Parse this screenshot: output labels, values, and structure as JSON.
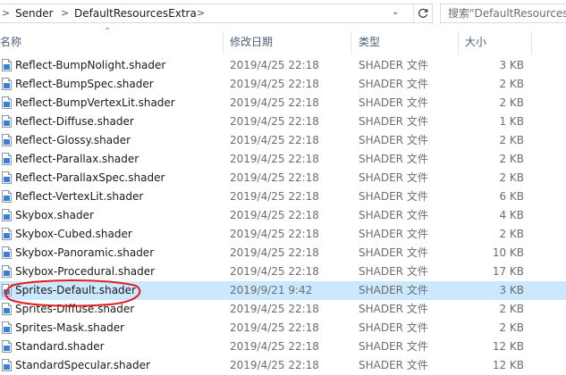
{
  "address_bar": {
    "crumbs": [
      "Sender",
      "DefaultResourcesExtra"
    ],
    "search_placeholder": "搜索\"DefaultResources"
  },
  "columns": {
    "name": "名称",
    "date": "修改日期",
    "type": "类型",
    "size": "大小"
  },
  "files": [
    {
      "name": "Reflect-BumpNolight.shader",
      "date": "2019/4/25 22:18",
      "type": "SHADER 文件",
      "size": "3 KB"
    },
    {
      "name": "Reflect-BumpSpec.shader",
      "date": "2019/4/25 22:18",
      "type": "SHADER 文件",
      "size": "2 KB"
    },
    {
      "name": "Reflect-BumpVertexLit.shader",
      "date": "2019/4/25 22:18",
      "type": "SHADER 文件",
      "size": "2 KB"
    },
    {
      "name": "Reflect-Diffuse.shader",
      "date": "2019/4/25 22:18",
      "type": "SHADER 文件",
      "size": "1 KB"
    },
    {
      "name": "Reflect-Glossy.shader",
      "date": "2019/4/25 22:18",
      "type": "SHADER 文件",
      "size": "2 KB"
    },
    {
      "name": "Reflect-Parallax.shader",
      "date": "2019/4/25 22:18",
      "type": "SHADER 文件",
      "size": "2 KB"
    },
    {
      "name": "Reflect-ParallaxSpec.shader",
      "date": "2019/4/25 22:18",
      "type": "SHADER 文件",
      "size": "2 KB"
    },
    {
      "name": "Reflect-VertexLit.shader",
      "date": "2019/4/25 22:18",
      "type": "SHADER 文件",
      "size": "6 KB"
    },
    {
      "name": "Skybox.shader",
      "date": "2019/4/25 22:18",
      "type": "SHADER 文件",
      "size": "4 KB"
    },
    {
      "name": "Skybox-Cubed.shader",
      "date": "2019/4/25 22:18",
      "type": "SHADER 文件",
      "size": "2 KB"
    },
    {
      "name": "Skybox-Panoramic.shader",
      "date": "2019/4/25 22:18",
      "type": "SHADER 文件",
      "size": "10 KB"
    },
    {
      "name": "Skybox-Procedural.shader",
      "date": "2019/4/25 22:18",
      "type": "SHADER 文件",
      "size": "17 KB"
    },
    {
      "name": "Sprites-Default.shader",
      "date": "2019/9/21 9:42",
      "type": "SHADER 文件",
      "size": "3 KB",
      "selected": true
    },
    {
      "name": "Sprites-Diffuse.shader",
      "date": "2019/4/25 22:18",
      "type": "SHADER 文件",
      "size": "2 KB"
    },
    {
      "name": "Sprites-Mask.shader",
      "date": "2019/4/25 22:18",
      "type": "SHADER 文件",
      "size": "2 KB"
    },
    {
      "name": "Standard.shader",
      "date": "2019/4/25 22:18",
      "type": "SHADER 文件",
      "size": "12 KB"
    },
    {
      "name": "StandardSpecular.shader",
      "date": "2019/4/25 22:18",
      "type": "SHADER 文件",
      "size": "12 KB"
    }
  ],
  "colors": {
    "selection": "#cce8ff",
    "annotation": "#e0201b",
    "header_text": "#4c607a",
    "secondary_text": "#6d6d6d"
  }
}
